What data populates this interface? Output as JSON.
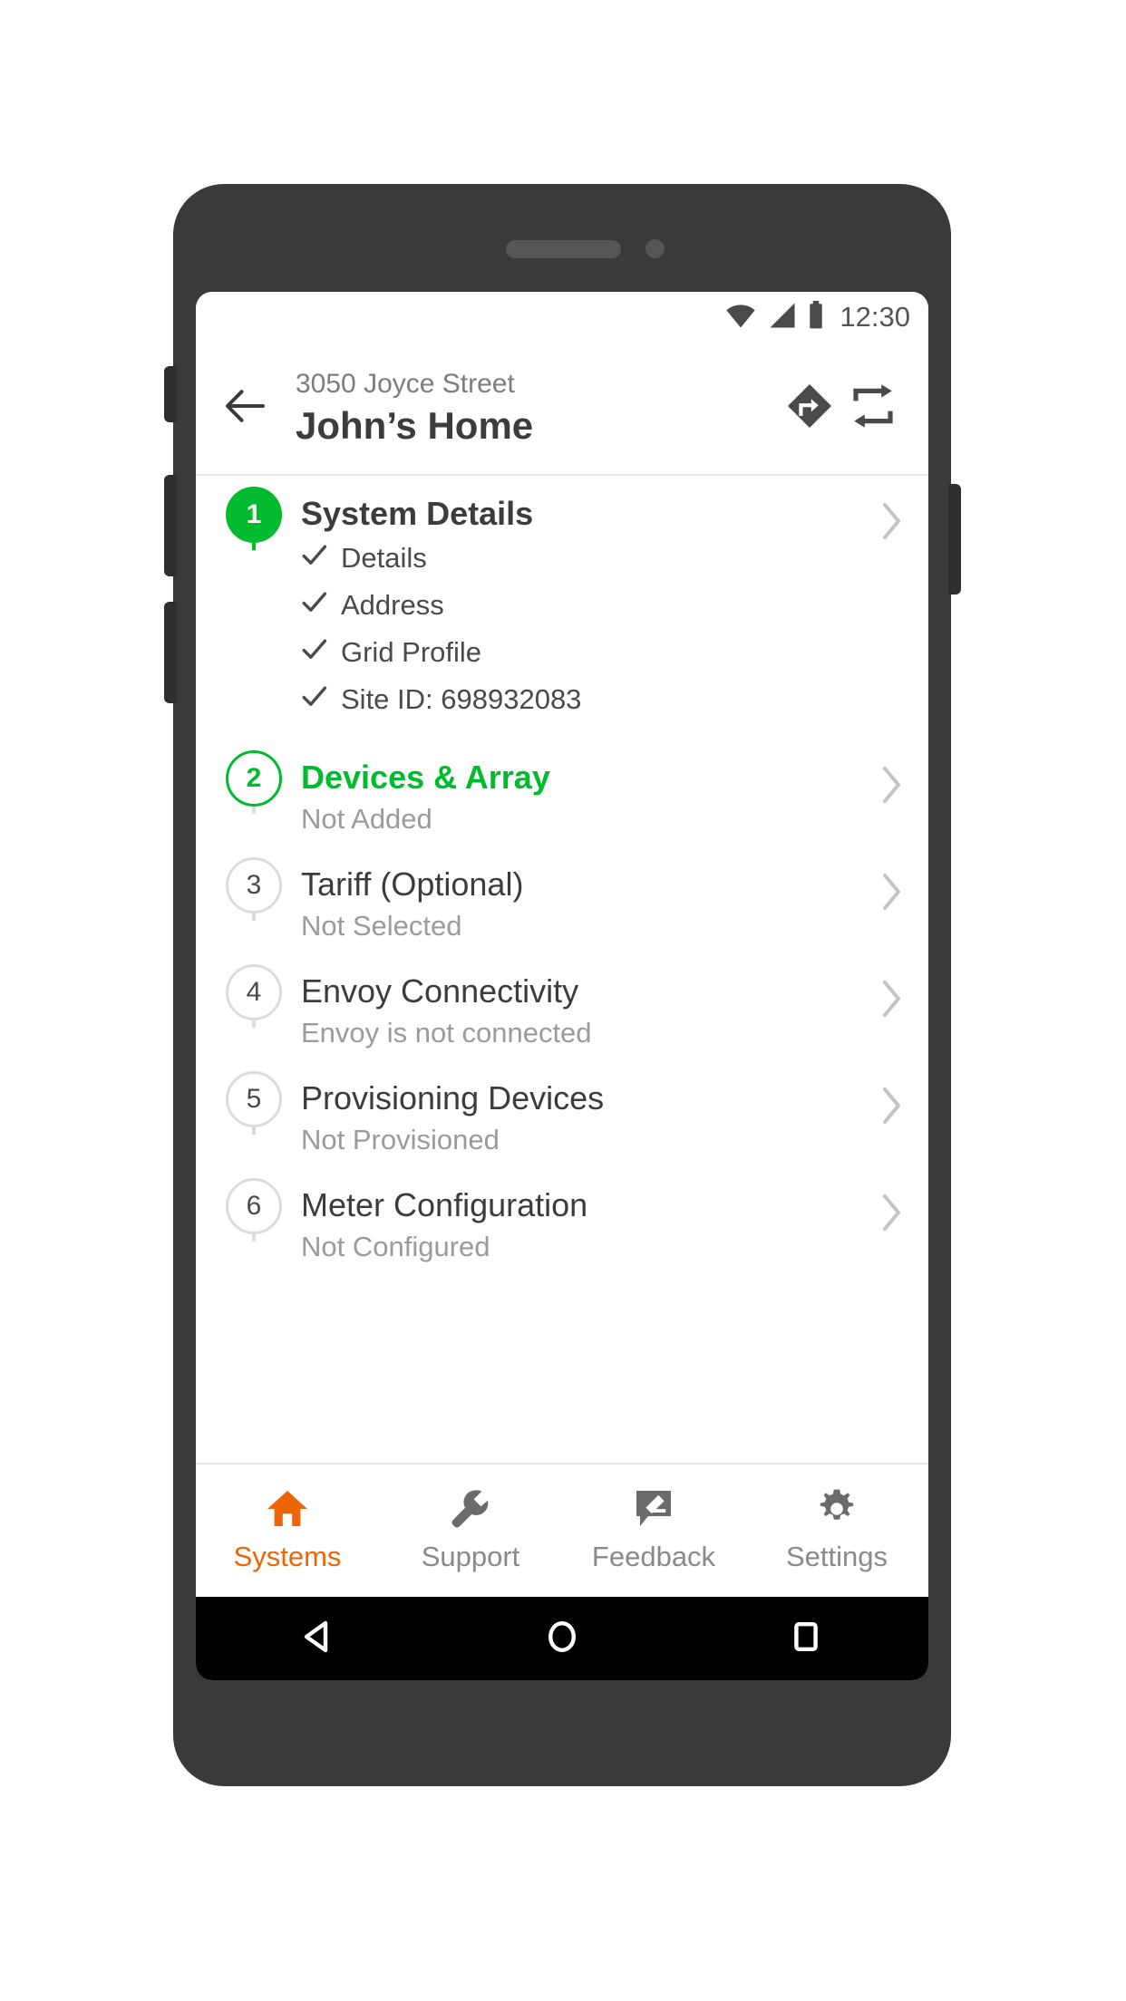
{
  "status_bar": {
    "time": "12:30",
    "icons": [
      "wifi-icon",
      "cellular-signal-icon",
      "battery-icon"
    ]
  },
  "header": {
    "back_icon": "arrow-left-icon",
    "subtitle": "3050 Joyce Street",
    "title": "John’s Home",
    "actions": [
      {
        "name": "directions-icon",
        "label": "Directions"
      },
      {
        "name": "swap-icon",
        "label": "Swap"
      }
    ]
  },
  "steps": [
    {
      "number": "1",
      "title": "System Details",
      "state": "completed",
      "status": "",
      "substeps": [
        "Details",
        "Address",
        "Grid Profile",
        "Site ID: 698932083"
      ]
    },
    {
      "number": "2",
      "title": "Devices & Array",
      "state": "active",
      "status": "Not Added",
      "substeps": []
    },
    {
      "number": "3",
      "title": "Tariff (Optional)",
      "state": "pending",
      "status": "Not Selected",
      "substeps": []
    },
    {
      "number": "4",
      "title": "Envoy Connectivity",
      "state": "pending",
      "status": "Envoy is not connected",
      "substeps": []
    },
    {
      "number": "5",
      "title": "Provisioning Devices",
      "state": "pending",
      "status": "Not Provisioned",
      "substeps": []
    },
    {
      "number": "6",
      "title": "Meter Configuration",
      "state": "pending",
      "status": "Not Configured",
      "substeps": []
    }
  ],
  "tab_bar": {
    "items": [
      {
        "label": "Systems",
        "icon": "home-icon",
        "active": true
      },
      {
        "label": "Support",
        "icon": "wrench-icon",
        "active": false
      },
      {
        "label": "Feedback",
        "icon": "feedback-icon",
        "active": false
      },
      {
        "label": "Settings",
        "icon": "gear-icon",
        "active": false
      }
    ]
  },
  "nav_bar": {
    "items": [
      {
        "name": "android-back-icon"
      },
      {
        "name": "android-home-icon"
      },
      {
        "name": "android-recents-icon"
      }
    ]
  },
  "colors": {
    "green": "#00bb2d",
    "orange": "#ec6608",
    "text_dark": "#3c3c3c",
    "text_muted": "#9b9b9b",
    "divider": "#e6e6e6"
  }
}
